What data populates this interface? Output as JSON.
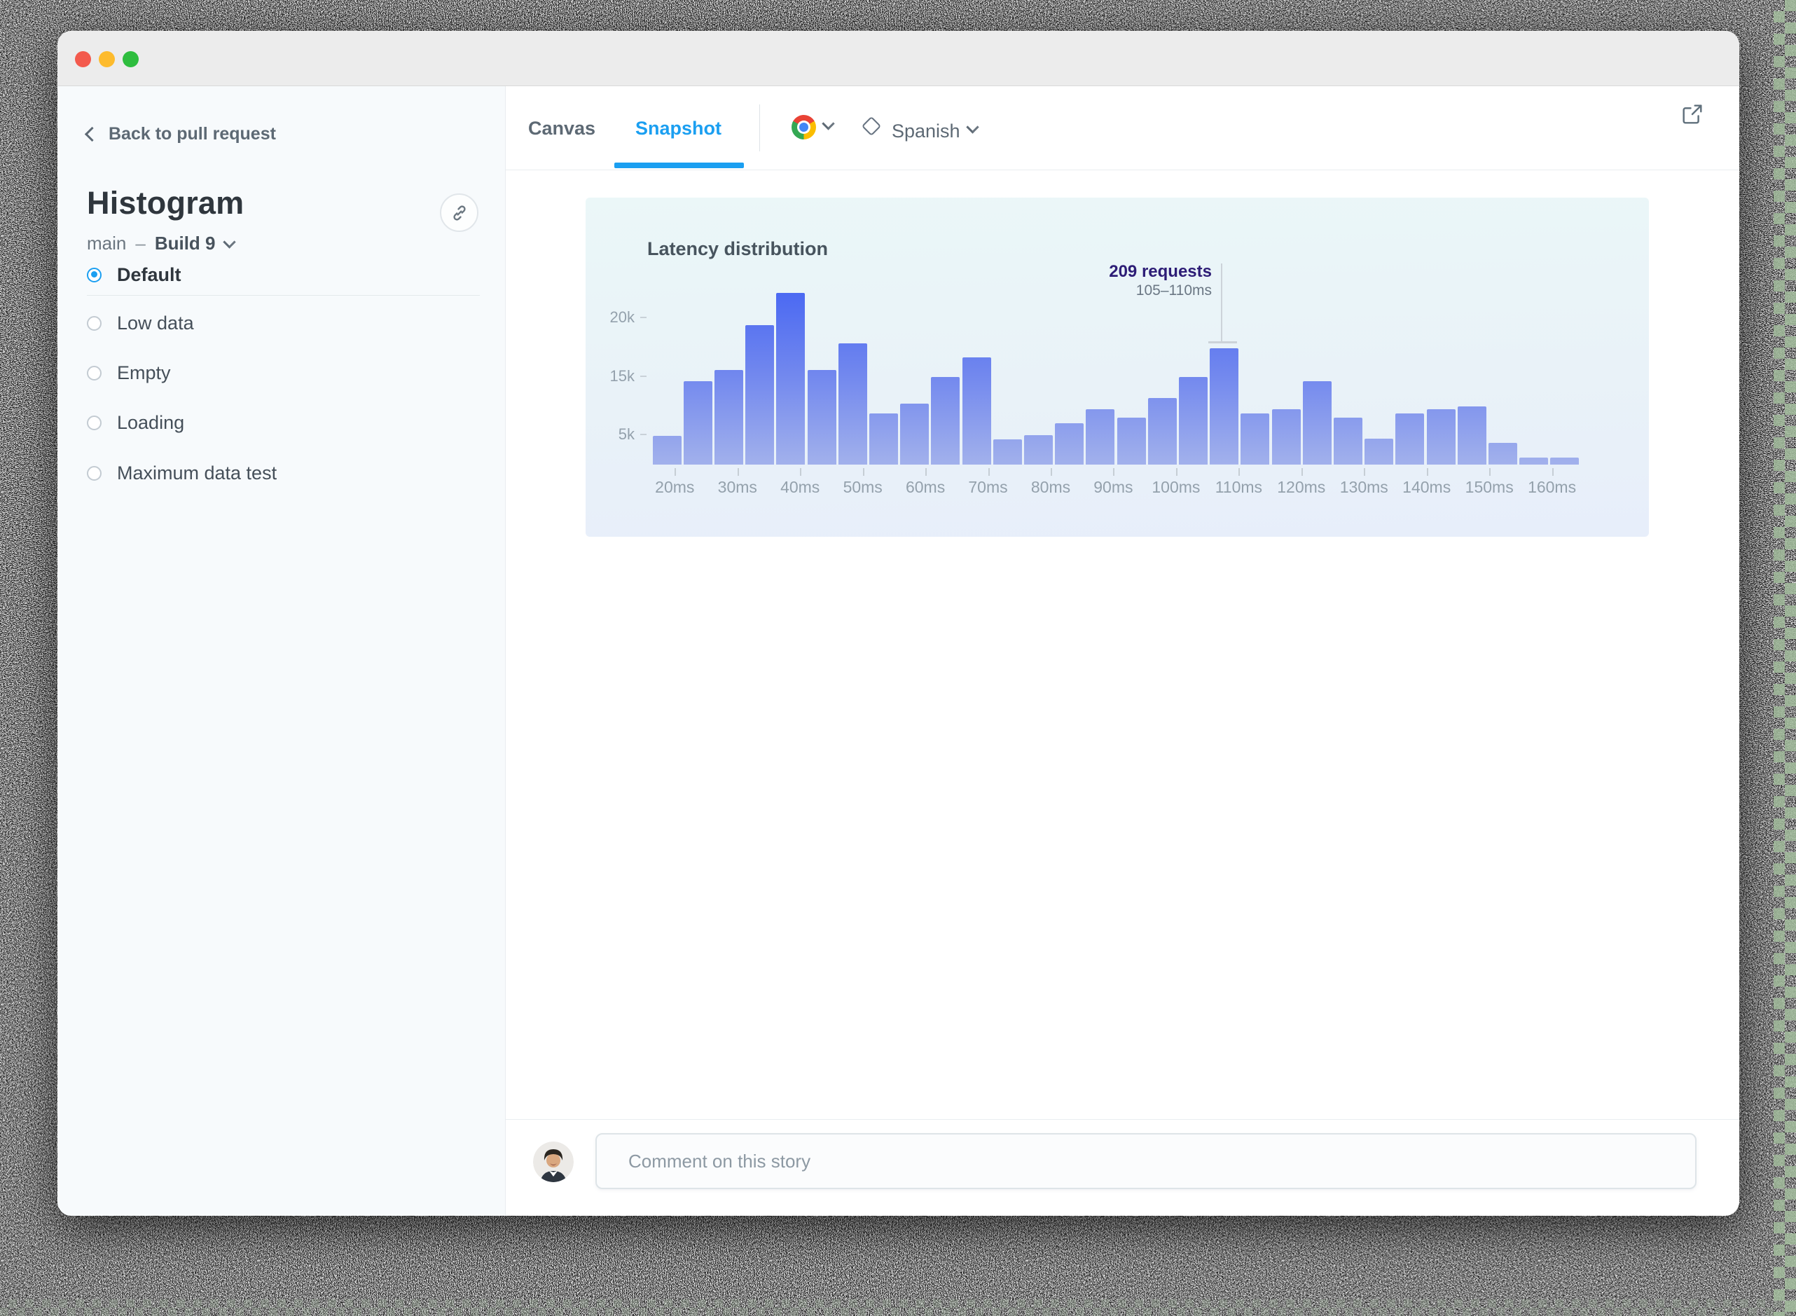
{
  "sidebar": {
    "back_label": "Back to pull request",
    "story_title": "Histogram",
    "branch": "main",
    "separator": "–",
    "build": "Build 9",
    "stories": [
      {
        "label": "Default",
        "selected": true
      },
      {
        "label": "Low data",
        "selected": false
      },
      {
        "label": "Empty",
        "selected": false
      },
      {
        "label": "Loading",
        "selected": false
      },
      {
        "label": "Maximum data test",
        "selected": false
      }
    ]
  },
  "tabs": {
    "canvas": "Canvas",
    "snapshot": "Snapshot",
    "browser_icon": "chrome-icon",
    "locale_icon": "diamond-icon",
    "locale": "Spanish"
  },
  "colors": {
    "accent_blue": "#1b9ff1",
    "bar_top": "#4b69f2",
    "bar_bottom": "#a2b1ec",
    "annotation_text": "#2d1d76",
    "chart_bg_top": "#ebf7f8",
    "chart_bg_bottom": "#e7eefa"
  },
  "chart_data": {
    "type": "bar",
    "subtype": "histogram",
    "title": "Latency distribution",
    "x_unit": "ms",
    "bin_width_ms": 5,
    "bins": [
      "15–20",
      "20–25",
      "25–30",
      "30–35",
      "35–40",
      "40–45",
      "45–50",
      "50–55",
      "55–60",
      "60–65",
      "65–70",
      "70–75",
      "75–80",
      "80–85",
      "85–90",
      "90–95",
      "95–100",
      "100–105",
      "105–110",
      "110–115",
      "115–120",
      "120–125",
      "125–130",
      "130–135",
      "135–140",
      "140–145",
      "145–150",
      "150–155",
      "155–160",
      "160–165"
    ],
    "values": [
      4900,
      14150,
      16050,
      23550,
      28950,
      16000,
      20500,
      8650,
      10300,
      14800,
      18100,
      4350,
      5000,
      7050,
      9400,
      7950,
      11250,
      14800,
      19600,
      8650,
      9400,
      14100,
      7950,
      4400,
      8650,
      9400,
      9850,
      3650,
      1250,
      1250
    ],
    "y_tick_labels": [
      "20k",
      "15k",
      "5k"
    ],
    "x_tick_labels": [
      "20ms",
      "30ms",
      "40ms",
      "50ms",
      "60ms",
      "70ms",
      "80ms",
      "90ms",
      "100ms",
      "110ms",
      "120ms",
      "130ms",
      "140ms",
      "150ms",
      "160ms"
    ],
    "annotation": {
      "label": "209 requests",
      "range": "105–110ms",
      "bin_index": 18
    },
    "grid": false,
    "legend": false
  },
  "comment": {
    "placeholder": "Comment on this story"
  }
}
